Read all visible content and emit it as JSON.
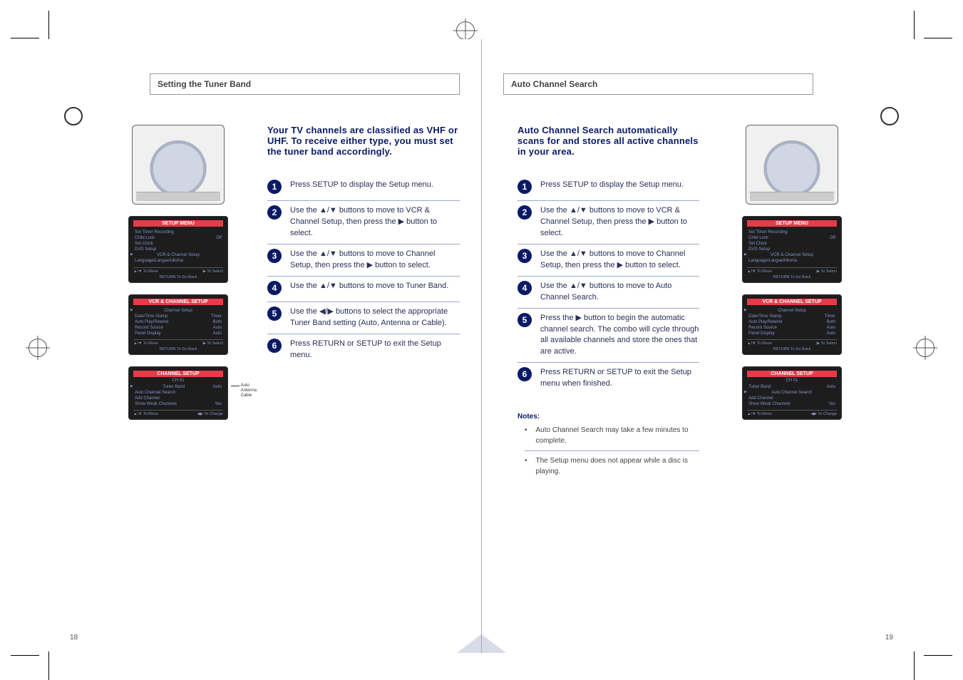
{
  "left": {
    "title": "Setting the Tuner Band",
    "intro": "Your TV channels are classified as VHF or UHF. To receive either type, you must set the tuner band accordingly.",
    "steps": [
      {
        "n": 1,
        "t": "Press SETUP to display the Setup menu."
      },
      {
        "n": 2,
        "t": "Use the ▲/▼ buttons to move to VCR & Channel Setup, then press the ▶ button to select."
      },
      {
        "n": 3,
        "t": "Use the ▲/▼ buttons to move to Channel Setup, then press the ▶ button to select."
      },
      {
        "n": 4,
        "t": "Use the ▲/▼ buttons to move to Tuner Band."
      },
      {
        "n": 5,
        "t": "Use the ◀/▶ buttons to select the appropriate Tuner Band setting (Auto, Antenna or Cable)."
      },
      {
        "n": 6,
        "t": "Press RETURN or SETUP to exit the Setup menu."
      }
    ],
    "osd_setup": {
      "title": "SETUP MENU",
      "items": [
        {
          "l": "Set Timer Recording",
          "v": ""
        },
        {
          "l": "Child Lock",
          "v": "Off"
        },
        {
          "l": "Set Clock",
          "v": ""
        },
        {
          "l": "DVD Setup",
          "v": ""
        },
        {
          "l": "VCR & Channel Setup",
          "v": "",
          "sel": true
        },
        {
          "l": "Language/Langue/Idioma",
          "v": ""
        }
      ],
      "foot_l": "▲/▼ To Move",
      "foot_r": "▶ To Select",
      "foot2": "RETURN To Go Back"
    },
    "osd_vcrch": {
      "title": "VCR & CHANNEL SETUP",
      "items": [
        {
          "l": "Channel Setup",
          "v": "",
          "sel": true
        },
        {
          "l": "Date/Time Stamp",
          "v": "Timer"
        },
        {
          "l": "Auto Play/Rewind",
          "v": "Both"
        },
        {
          "l": "Record Source",
          "v": "Auto"
        },
        {
          "l": "Panel Display",
          "v": "Auto"
        }
      ],
      "foot_l": "▲/▼ To Move",
      "foot_r": "▶ To Select",
      "foot2": "RETURN To Go Back"
    },
    "osd_channel": {
      "title": "CHANNEL SETUP",
      "sub": "CH 01",
      "items": [
        {
          "l": "Tuner Band",
          "v": "Auto",
          "sel": true
        },
        {
          "l": "Auto Channel Search",
          "v": ""
        },
        {
          "l": "Add Channel",
          "v": ""
        },
        {
          "l": "Show Weak Channels",
          "v": "Yes"
        }
      ],
      "foot_l": "▲/▼ To Move",
      "foot_r": "◀▶ To Change",
      "foot2": ""
    },
    "callouts": [
      "Auto",
      "Antenna",
      "Cable"
    ],
    "page_num": "18"
  },
  "right": {
    "title": "Auto Channel Search",
    "intro": "Auto Channel Search automatically scans for and stores all active channels in your area.",
    "steps": [
      {
        "n": 1,
        "t": "Press SETUP to display the Setup menu."
      },
      {
        "n": 2,
        "t": "Use the ▲/▼ buttons to move to VCR & Channel Setup, then press the ▶ button to select."
      },
      {
        "n": 3,
        "t": "Use the ▲/▼ buttons to move to Channel Setup, then press the ▶ button to select."
      },
      {
        "n": 4,
        "t": "Use the ▲/▼ buttons to move to Auto Channel Search."
      },
      {
        "n": 5,
        "t": "Press the ▶ button to begin the automatic channel search. The combo will cycle through all available channels and store the ones that are active."
      },
      {
        "n": 6,
        "t": "Press RETURN or SETUP to exit the Setup menu when finished."
      }
    ],
    "notes": {
      "h": "Notes:",
      "items": [
        "Auto Channel Search may take a few minutes to complete.",
        "The Setup menu does not appear while a disc is playing."
      ]
    },
    "osd_setup": {
      "title": "SETUP MENU",
      "items": [
        {
          "l": "Set Timer Recording",
          "v": ""
        },
        {
          "l": "Child Lock",
          "v": "Off"
        },
        {
          "l": "Set Clock",
          "v": ""
        },
        {
          "l": "DVD Setup",
          "v": ""
        },
        {
          "l": "VCR & Channel Setup",
          "v": "",
          "sel": true
        },
        {
          "l": "Language/Langue/Idioma",
          "v": ""
        }
      ],
      "foot_l": "▲/▼ To Move",
      "foot_r": "▶ To Select",
      "foot2": "RETURN To Go Back"
    },
    "osd_vcrch": {
      "title": "VCR & CHANNEL SETUP",
      "items": [
        {
          "l": "Channel Setup",
          "v": "",
          "sel": true
        },
        {
          "l": "Date/Time Stamp",
          "v": "Timer"
        },
        {
          "l": "Auto Play/Rewind",
          "v": "Both"
        },
        {
          "l": "Record Source",
          "v": "Auto"
        },
        {
          "l": "Panel Display",
          "v": "Auto"
        }
      ],
      "foot_l": "▲/▼ To Move",
      "foot_r": "▶ To Select",
      "foot2": "RETURN To Go Back"
    },
    "osd_channel": {
      "title": "CHANNEL SETUP",
      "sub": "CH 01",
      "items": [
        {
          "l": "Tuner Band",
          "v": "Auto"
        },
        {
          "l": "Auto Channel Search",
          "v": "",
          "sel": true
        },
        {
          "l": "Add Channel",
          "v": ""
        },
        {
          "l": "Show Weak Channels",
          "v": "Yes"
        }
      ],
      "foot_l": "▲/▼ To Move",
      "foot_r": "◀▶ To Change",
      "foot2": ""
    },
    "page_num": "19"
  }
}
